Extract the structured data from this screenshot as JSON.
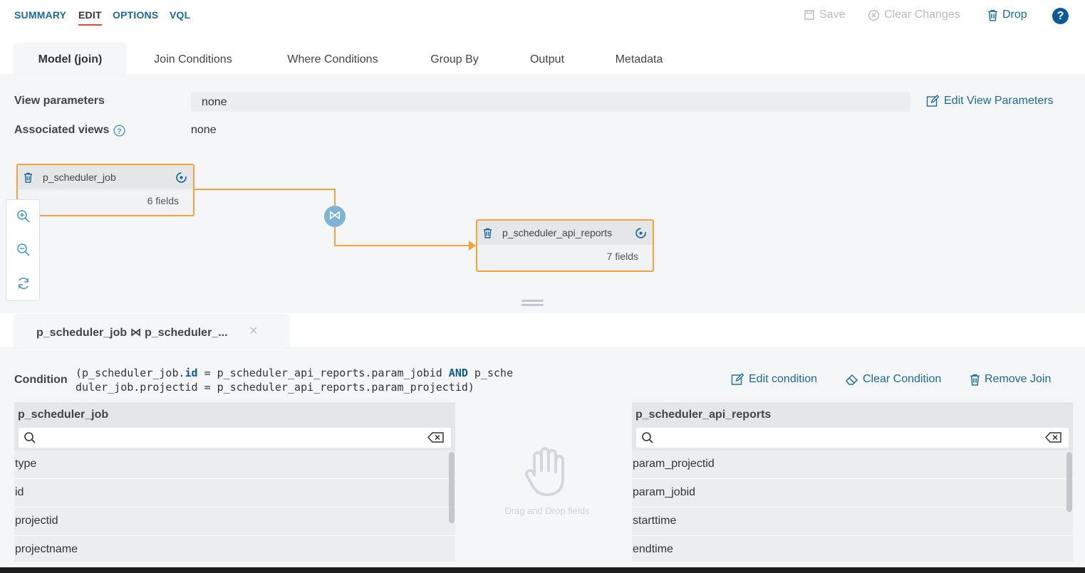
{
  "nav": {
    "items": [
      "SUMMARY",
      "EDIT",
      "OPTIONS",
      "VQL"
    ],
    "active": "EDIT"
  },
  "toolbar": {
    "save_label": "Save",
    "clear_changes_label": "Clear Changes",
    "drop_label": "Drop",
    "help_label": "?"
  },
  "tabs": [
    "Model (join)",
    "Join Conditions",
    "Where Conditions",
    "Group By",
    "Output",
    "Metadata"
  ],
  "view_params": {
    "label": "View parameters",
    "value": "none",
    "edit_label": "Edit View Parameters"
  },
  "associated": {
    "label": "Associated views",
    "value": "none"
  },
  "diagram": {
    "node1": {
      "name": "p_scheduler_job",
      "fields": "6 fields"
    },
    "node2": {
      "name": "p_scheduler_api_reports",
      "fields": "7 fields"
    },
    "join_symbol": "⋈"
  },
  "join_tab": {
    "label": "p_scheduler_job ⋈ p_scheduler_...",
    "close": "×"
  },
  "condition": {
    "label": "Condition",
    "line1_a": "(p_scheduler_job.",
    "line1_b": "id",
    "line1_c": " = p_scheduler_api_reports.param_jobid ",
    "line1_d": "AND",
    "line1_e": " p_sche",
    "line2": "duler_job.projectid = p_scheduler_api_reports.param_projectid)",
    "edit_label": "Edit condition",
    "clear_label": "Clear Condition",
    "remove_label": "Remove Join"
  },
  "left_list": {
    "title": "p_scheduler_job",
    "rows": [
      "type",
      "id",
      "projectid",
      "projectname"
    ]
  },
  "right_list": {
    "title": "p_scheduler_api_reports",
    "rows": [
      "param_projectid",
      "param_jobid",
      "starttime",
      "endtime"
    ]
  },
  "dnd_hint": "Drag and Drop fields",
  "colors": {
    "accent": "#1a6a9a",
    "node_border": "#f5a238",
    "active_underline": "#e0483b",
    "help": "#0b5a93"
  }
}
